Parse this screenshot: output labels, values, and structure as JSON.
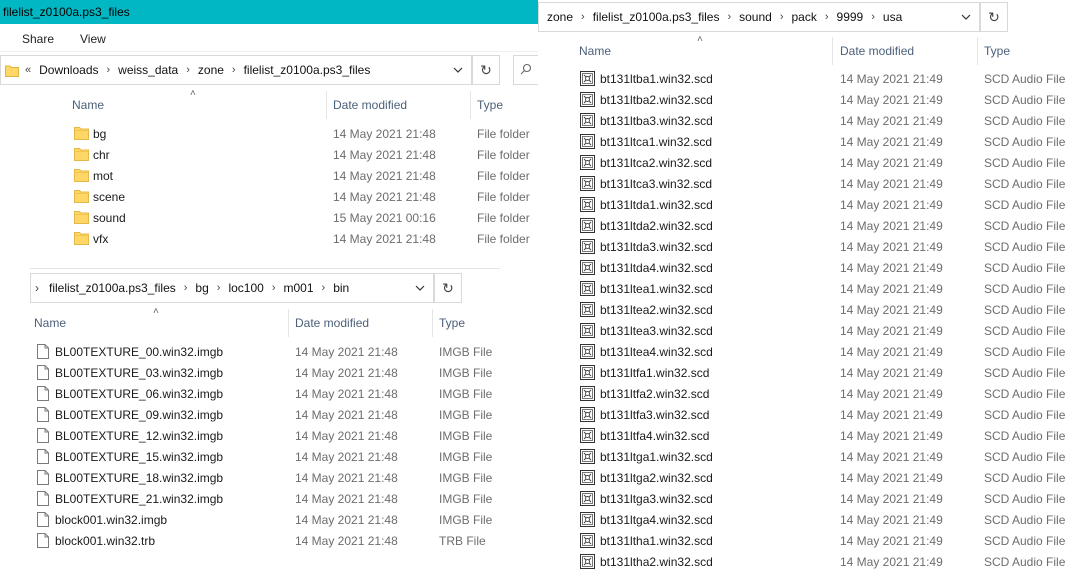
{
  "left_window": {
    "title": "filelist_z0100a.ps3_files",
    "ribbon": {
      "share": "Share",
      "view": "View"
    },
    "address": {
      "overflow": "«",
      "crumbs": [
        "Downloads",
        "weiss_data",
        "zone",
        "filelist_z0100a.ps3_files"
      ]
    },
    "columns": {
      "name": "Name",
      "date": "Date modified",
      "type": "Type"
    },
    "items": [
      {
        "name": "bg",
        "date": "14 May 2021 21:48",
        "type": "File folder"
      },
      {
        "name": "chr",
        "date": "14 May 2021 21:48",
        "type": "File folder"
      },
      {
        "name": "mot",
        "date": "14 May 2021 21:48",
        "type": "File folder"
      },
      {
        "name": "scene",
        "date": "14 May 2021 21:48",
        "type": "File folder"
      },
      {
        "name": "sound",
        "date": "15 May 2021 00:16",
        "type": "File folder"
      },
      {
        "name": "vfx",
        "date": "14 May 2021 21:48",
        "type": "File folder"
      }
    ]
  },
  "bin_window": {
    "address": {
      "crumbs": [
        "filelist_z0100a.ps3_files",
        "bg",
        "loc100",
        "m001",
        "bin"
      ]
    },
    "columns": {
      "name": "Name",
      "date": "Date modified",
      "type": "Type"
    },
    "items": [
      {
        "name": "BL00TEXTURE_00.win32.imgb",
        "date": "14 May 2021 21:48",
        "type": "IMGB File"
      },
      {
        "name": "BL00TEXTURE_03.win32.imgb",
        "date": "14 May 2021 21:48",
        "type": "IMGB File"
      },
      {
        "name": "BL00TEXTURE_06.win32.imgb",
        "date": "14 May 2021 21:48",
        "type": "IMGB File"
      },
      {
        "name": "BL00TEXTURE_09.win32.imgb",
        "date": "14 May 2021 21:48",
        "type": "IMGB File"
      },
      {
        "name": "BL00TEXTURE_12.win32.imgb",
        "date": "14 May 2021 21:48",
        "type": "IMGB File"
      },
      {
        "name": "BL00TEXTURE_15.win32.imgb",
        "date": "14 May 2021 21:48",
        "type": "IMGB File"
      },
      {
        "name": "BL00TEXTURE_18.win32.imgb",
        "date": "14 May 2021 21:48",
        "type": "IMGB File"
      },
      {
        "name": "BL00TEXTURE_21.win32.imgb",
        "date": "14 May 2021 21:48",
        "type": "IMGB File"
      },
      {
        "name": "block001.win32.imgb",
        "date": "14 May 2021 21:48",
        "type": "IMGB File"
      },
      {
        "name": "block001.win32.trb",
        "date": "14 May 2021 21:48",
        "type": "TRB File"
      }
    ]
  },
  "right_window": {
    "address": {
      "crumbs": [
        "zone",
        "filelist_z0100a.ps3_files",
        "sound",
        "pack",
        "9999",
        "usa"
      ]
    },
    "columns": {
      "name": "Name",
      "date": "Date modified",
      "type": "Type"
    },
    "items": [
      {
        "name": "bt131ltba1.win32.scd",
        "date": "14 May 2021 21:49",
        "type": "SCD Audio File"
      },
      {
        "name": "bt131ltba2.win32.scd",
        "date": "14 May 2021 21:49",
        "type": "SCD Audio File"
      },
      {
        "name": "bt131ltba3.win32.scd",
        "date": "14 May 2021 21:49",
        "type": "SCD Audio File"
      },
      {
        "name": "bt131ltca1.win32.scd",
        "date": "14 May 2021 21:49",
        "type": "SCD Audio File"
      },
      {
        "name": "bt131ltca2.win32.scd",
        "date": "14 May 2021 21:49",
        "type": "SCD Audio File"
      },
      {
        "name": "bt131ltca3.win32.scd",
        "date": "14 May 2021 21:49",
        "type": "SCD Audio File"
      },
      {
        "name": "bt131ltda1.win32.scd",
        "date": "14 May 2021 21:49",
        "type": "SCD Audio File"
      },
      {
        "name": "bt131ltda2.win32.scd",
        "date": "14 May 2021 21:49",
        "type": "SCD Audio File"
      },
      {
        "name": "bt131ltda3.win32.scd",
        "date": "14 May 2021 21:49",
        "type": "SCD Audio File"
      },
      {
        "name": "bt131ltda4.win32.scd",
        "date": "14 May 2021 21:49",
        "type": "SCD Audio File"
      },
      {
        "name": "bt131ltea1.win32.scd",
        "date": "14 May 2021 21:49",
        "type": "SCD Audio File"
      },
      {
        "name": "bt131ltea2.win32.scd",
        "date": "14 May 2021 21:49",
        "type": "SCD Audio File"
      },
      {
        "name": "bt131ltea3.win32.scd",
        "date": "14 May 2021 21:49",
        "type": "SCD Audio File"
      },
      {
        "name": "bt131ltea4.win32.scd",
        "date": "14 May 2021 21:49",
        "type": "SCD Audio File"
      },
      {
        "name": "bt131ltfa1.win32.scd",
        "date": "14 May 2021 21:49",
        "type": "SCD Audio File"
      },
      {
        "name": "bt131ltfa2.win32.scd",
        "date": "14 May 2021 21:49",
        "type": "SCD Audio File"
      },
      {
        "name": "bt131ltfa3.win32.scd",
        "date": "14 May 2021 21:49",
        "type": "SCD Audio File"
      },
      {
        "name": "bt131ltfa4.win32.scd",
        "date": "14 May 2021 21:49",
        "type": "SCD Audio File"
      },
      {
        "name": "bt131ltga1.win32.scd",
        "date": "14 May 2021 21:49",
        "type": "SCD Audio File"
      },
      {
        "name": "bt131ltga2.win32.scd",
        "date": "14 May 2021 21:49",
        "type": "SCD Audio File"
      },
      {
        "name": "bt131ltga3.win32.scd",
        "date": "14 May 2021 21:49",
        "type": "SCD Audio File"
      },
      {
        "name": "bt131ltga4.win32.scd",
        "date": "14 May 2021 21:49",
        "type": "SCD Audio File"
      },
      {
        "name": "bt131ltha1.win32.scd",
        "date": "14 May 2021 21:49",
        "type": "SCD Audio File"
      },
      {
        "name": "bt131ltha2.win32.scd",
        "date": "14 May 2021 21:49",
        "type": "SCD Audio File"
      }
    ]
  }
}
